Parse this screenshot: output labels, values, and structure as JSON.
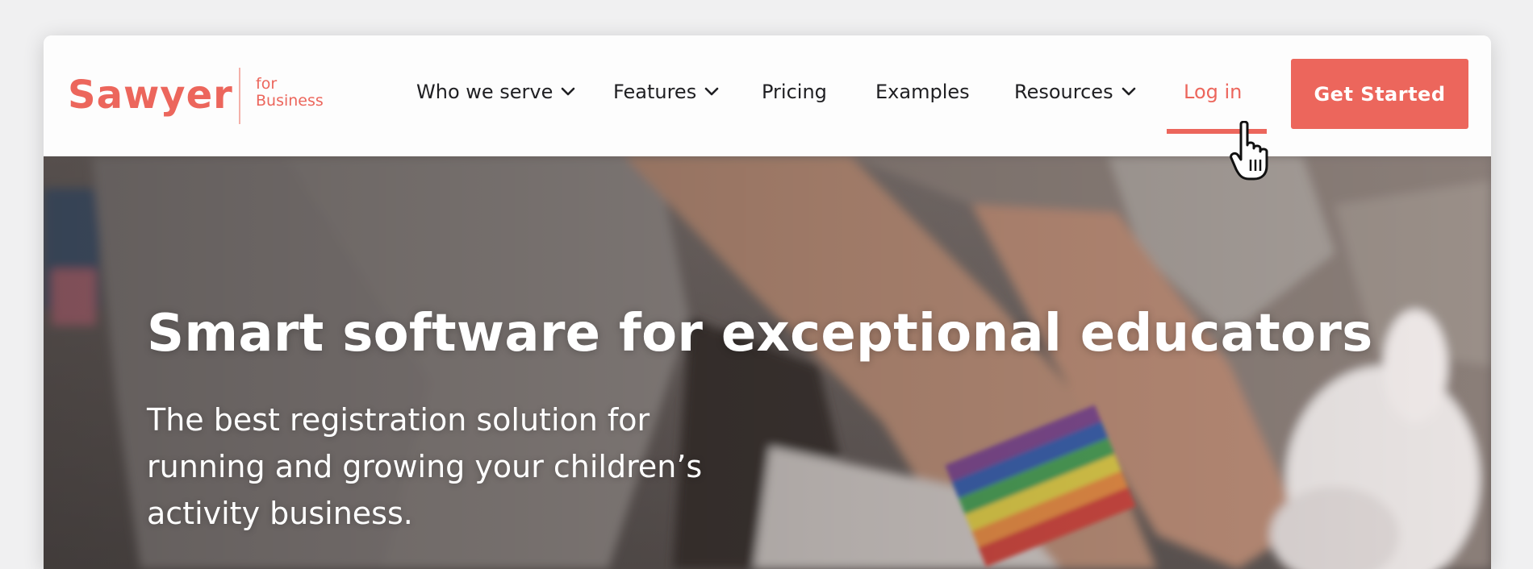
{
  "brand": {
    "name": "Sawyer",
    "sub_line1": "for",
    "sub_line2": "Business",
    "accent_color": "#ec665c"
  },
  "nav": {
    "items": [
      {
        "label": "Who we serve",
        "has_dropdown": true
      },
      {
        "label": "Features",
        "has_dropdown": true
      },
      {
        "label": "Pricing",
        "has_dropdown": false
      },
      {
        "label": "Examples",
        "has_dropdown": false
      },
      {
        "label": "Resources",
        "has_dropdown": true
      }
    ],
    "login_label": "Log in",
    "cta_label": "Get Started",
    "dropdown_icon": "chevron-down-icon",
    "pointer_icon": "hand-pointer-icon"
  },
  "hero": {
    "title": "Smart software for exceptional educators",
    "subtitle_line1": "The best registration solution for",
    "subtitle_line2": "running and growing your children’s",
    "subtitle_line3": "activity business."
  }
}
